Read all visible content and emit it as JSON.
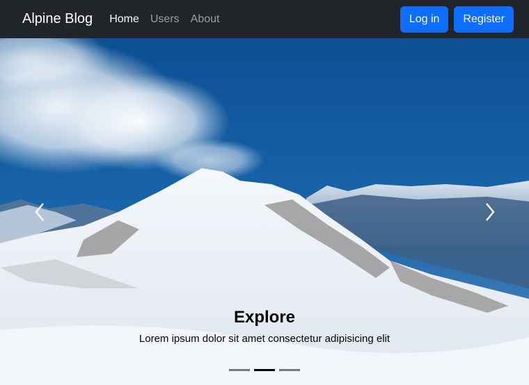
{
  "navbar": {
    "brand": "Alpine Blog",
    "links": [
      {
        "label": "Home",
        "active": true
      },
      {
        "label": "Users",
        "active": false
      },
      {
        "label": "About",
        "active": false
      }
    ],
    "login_label": "Log in",
    "register_label": "Register",
    "background": "#212529",
    "button_color": "#0d6efd"
  },
  "carousel": {
    "caption_title": "Explore",
    "caption_text": "Lorem ipsum dolor sit amet consectetur adipisicing elit",
    "prev_icon": "chevron-left-icon",
    "next_icon": "chevron-right-icon",
    "slide_count": 3,
    "active_slide": 2
  }
}
